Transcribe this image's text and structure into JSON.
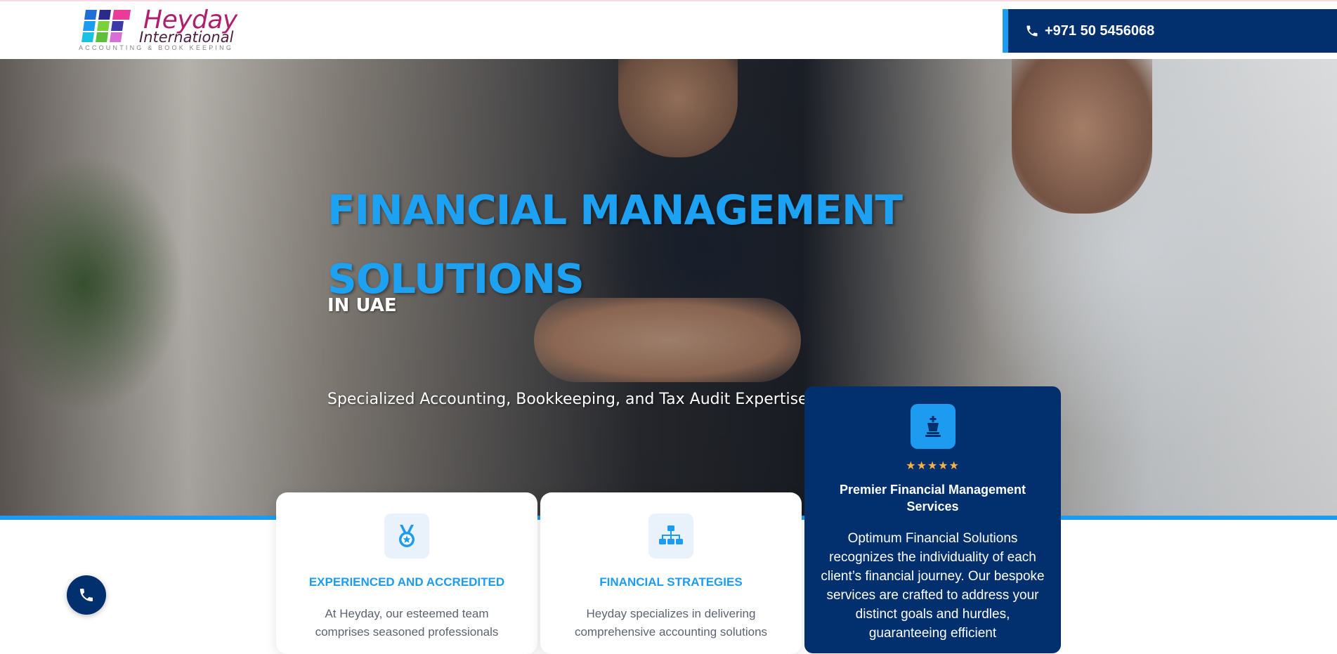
{
  "header": {
    "logo_word": "Heyday",
    "logo_word2": "International",
    "logo_tagline": "ACCOUNTING & BOOK KEEPING",
    "phone": "+971 50 5456068"
  },
  "hero": {
    "title_line1": "FINANCIAL MANAGEMENT",
    "title_line2": "SOLUTIONS",
    "subtitle": "IN UAE",
    "description": "Specialized Accounting, Bookkeeping, and Tax Audit Expertise"
  },
  "features": [
    {
      "icon": "medal-icon",
      "title": "EXPERIENCED AND ACCREDITED",
      "text": "At Heyday, our esteemed team comprises seasoned professionals"
    },
    {
      "icon": "hierarchy-icon",
      "title": "FINANCIAL STRATEGIES",
      "text": "Heyday specializes in delivering comprehensive accounting solutions"
    }
  ],
  "highlight": {
    "icon": "chess-king-icon",
    "stars": "★★★★★",
    "rating": 5,
    "title": "Premier Financial Management Services",
    "text": "Optimum Financial Solutions recognizes the individuality of each client’s financial journey. Our bespoke services are crafted to address your distinct goals and hurdles, guaranteeing efficient"
  },
  "colors": {
    "navy": "#02306f",
    "accent_blue": "#1d9bf0",
    "star": "#f5b342",
    "logo_magenta": "#b01e6e"
  }
}
